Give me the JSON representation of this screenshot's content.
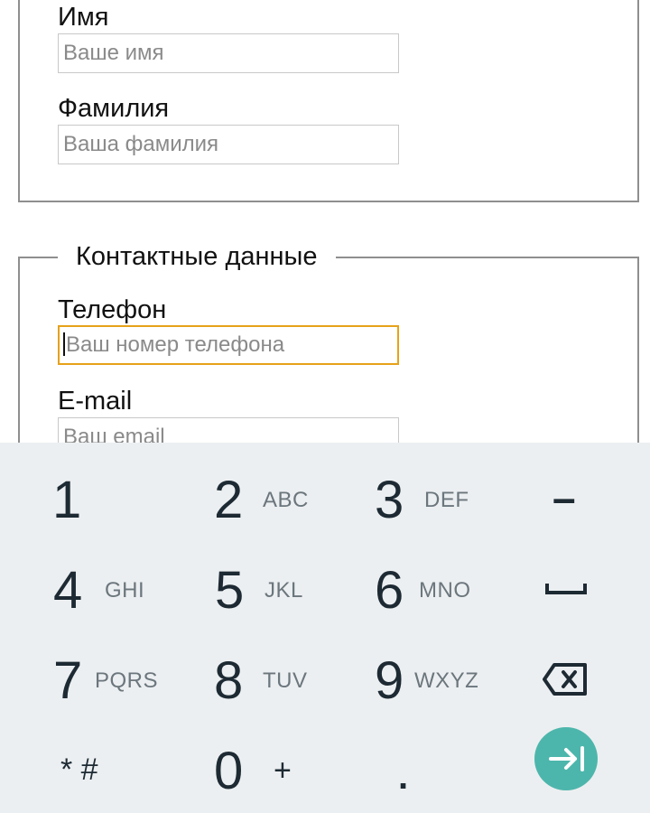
{
  "form": {
    "personal": {
      "first_name": {
        "label": "Имя",
        "placeholder": "Ваше имя"
      },
      "last_name": {
        "label": "Фамилия",
        "placeholder": "Ваша фамилия"
      }
    },
    "contact": {
      "legend": "Контактные данные",
      "phone": {
        "label": "Телефон",
        "placeholder": "Ваш номер телефона",
        "focused": true
      },
      "email": {
        "label": "E-mail",
        "placeholder": "Ваш email"
      }
    }
  },
  "keyboard": {
    "keys": {
      "k1": {
        "digit": "1",
        "letters": ""
      },
      "k2": {
        "digit": "2",
        "letters": "ABC"
      },
      "k3": {
        "digit": "3",
        "letters": "DEF"
      },
      "k4": {
        "digit": "4",
        "letters": "GHI"
      },
      "k5": {
        "digit": "5",
        "letters": "JKL"
      },
      "k6": {
        "digit": "6",
        "letters": "MNO"
      },
      "k7": {
        "digit": "7",
        "letters": "PQRS"
      },
      "k8": {
        "digit": "8",
        "letters": "TUV"
      },
      "k9": {
        "digit": "9",
        "letters": "WXYZ"
      },
      "k0": {
        "digit": "0",
        "letters": "+"
      }
    },
    "star_hash": "* #",
    "dash": "–",
    "dot": ".",
    "space_icon": "space-bar-icon",
    "backspace_icon": "backspace-icon",
    "next_icon": "tab-next-icon",
    "colors": {
      "background": "#eceff1",
      "digit": "#1d2a33",
      "letters": "#6b767d",
      "next_button": "#4db6ac",
      "focus_border": "#e6a21a"
    }
  }
}
